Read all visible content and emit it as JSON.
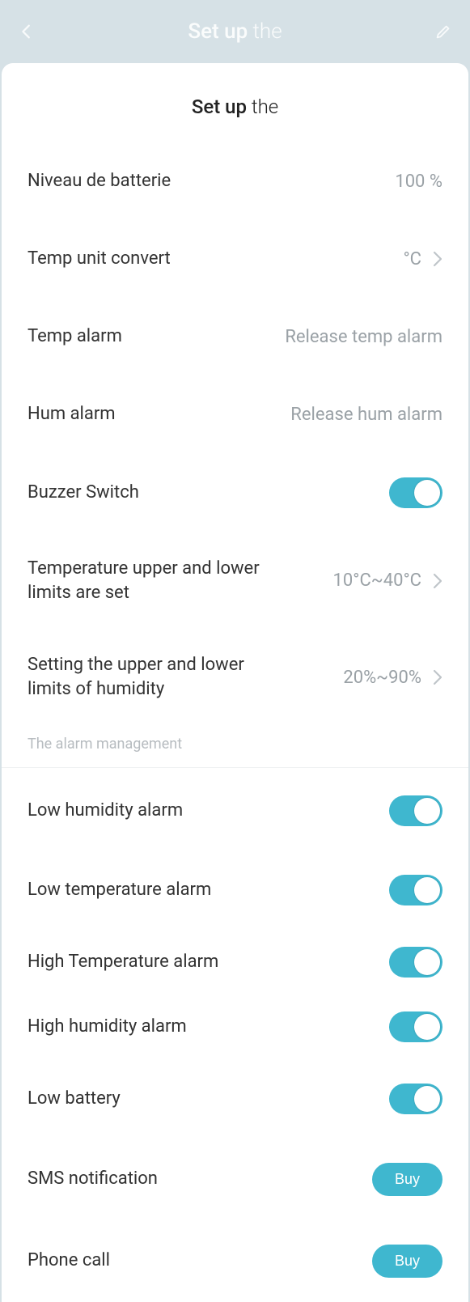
{
  "header": {
    "title_bold": "Set up",
    "title_rest": " the"
  },
  "card": {
    "title_bold": "Set up",
    "title_rest": " the"
  },
  "rows": {
    "battery": {
      "label": "Niveau de batterie",
      "value": "100 %"
    },
    "temp_unit": {
      "label": "Temp unit convert",
      "value": "°C"
    },
    "temp_alarm": {
      "label": "Temp alarm",
      "value": "Release temp alarm"
    },
    "hum_alarm": {
      "label": "Hum alarm",
      "value": "Release hum alarm"
    },
    "buzzer": {
      "label": "Buzzer Switch"
    },
    "temp_limits": {
      "label": "Temperature upper and lower limits are set",
      "value": "10°C~40°C"
    },
    "hum_limits": {
      "label": "Setting the upper and lower limits of humidity",
      "value": "20%~90%"
    }
  },
  "section_alarm": "The alarm management",
  "alarms": {
    "low_hum": {
      "label": "Low humidity alarm"
    },
    "low_temp": {
      "label": "Low temperature alarm"
    },
    "high_temp": {
      "label": "High Temperature alarm"
    },
    "high_hum": {
      "label": "High humidity alarm"
    },
    "low_batt": {
      "label": "Low battery"
    }
  },
  "notifications": {
    "sms": {
      "label": "SMS notification",
      "action": "Buy"
    },
    "phone": {
      "label": "Phone call",
      "action": "Buy"
    }
  }
}
